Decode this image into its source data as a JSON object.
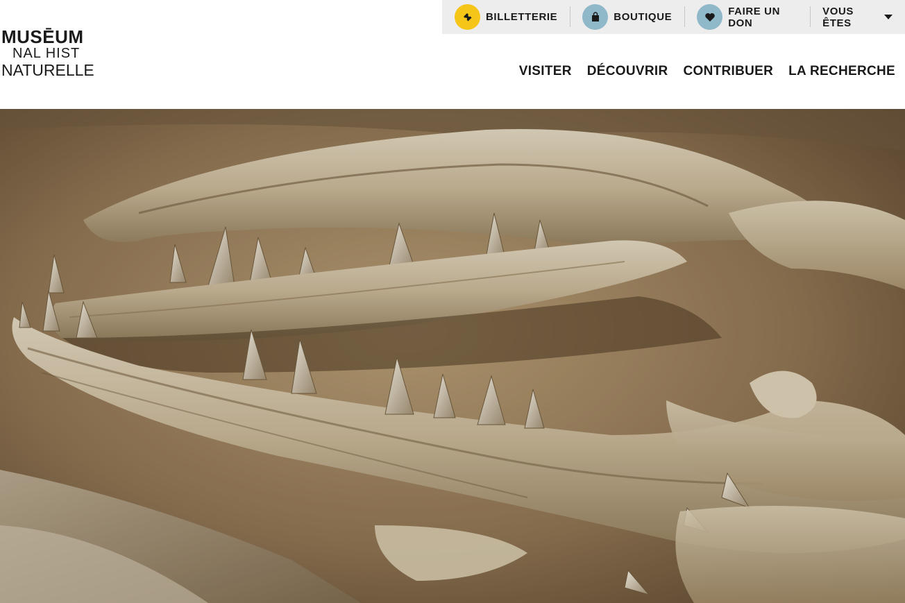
{
  "utility_bar": {
    "items": [
      {
        "label": "BILLETTERIE",
        "icon": "ticket-icon",
        "icon_bg": "#f5c518"
      },
      {
        "label": "BOUTIQUE",
        "icon": "shopping-bag-icon",
        "icon_bg": "#8fb8c8"
      },
      {
        "label": "FAIRE UN DON",
        "icon": "heart-icon",
        "icon_bg": "#8fb8c8"
      },
      {
        "label": "VOUS ÊTES",
        "icon": "caret-down-icon"
      }
    ]
  },
  "logo": {
    "line1": "MUSĒUM",
    "line2": "NAL HIST",
    "line3": "NATURELLE"
  },
  "main_nav": {
    "items": [
      "VISITER",
      "DÉCOUVRIR",
      "CONTRIBUER",
      "LA RECHERCHE"
    ]
  },
  "hero": {
    "image": "fossil-skull-jaw-photo"
  },
  "colors": {
    "utility_bg": "#ededed",
    "text": "#1a1a1a",
    "accent_yellow": "#f5c518",
    "accent_blue": "#8fb8c8"
  }
}
